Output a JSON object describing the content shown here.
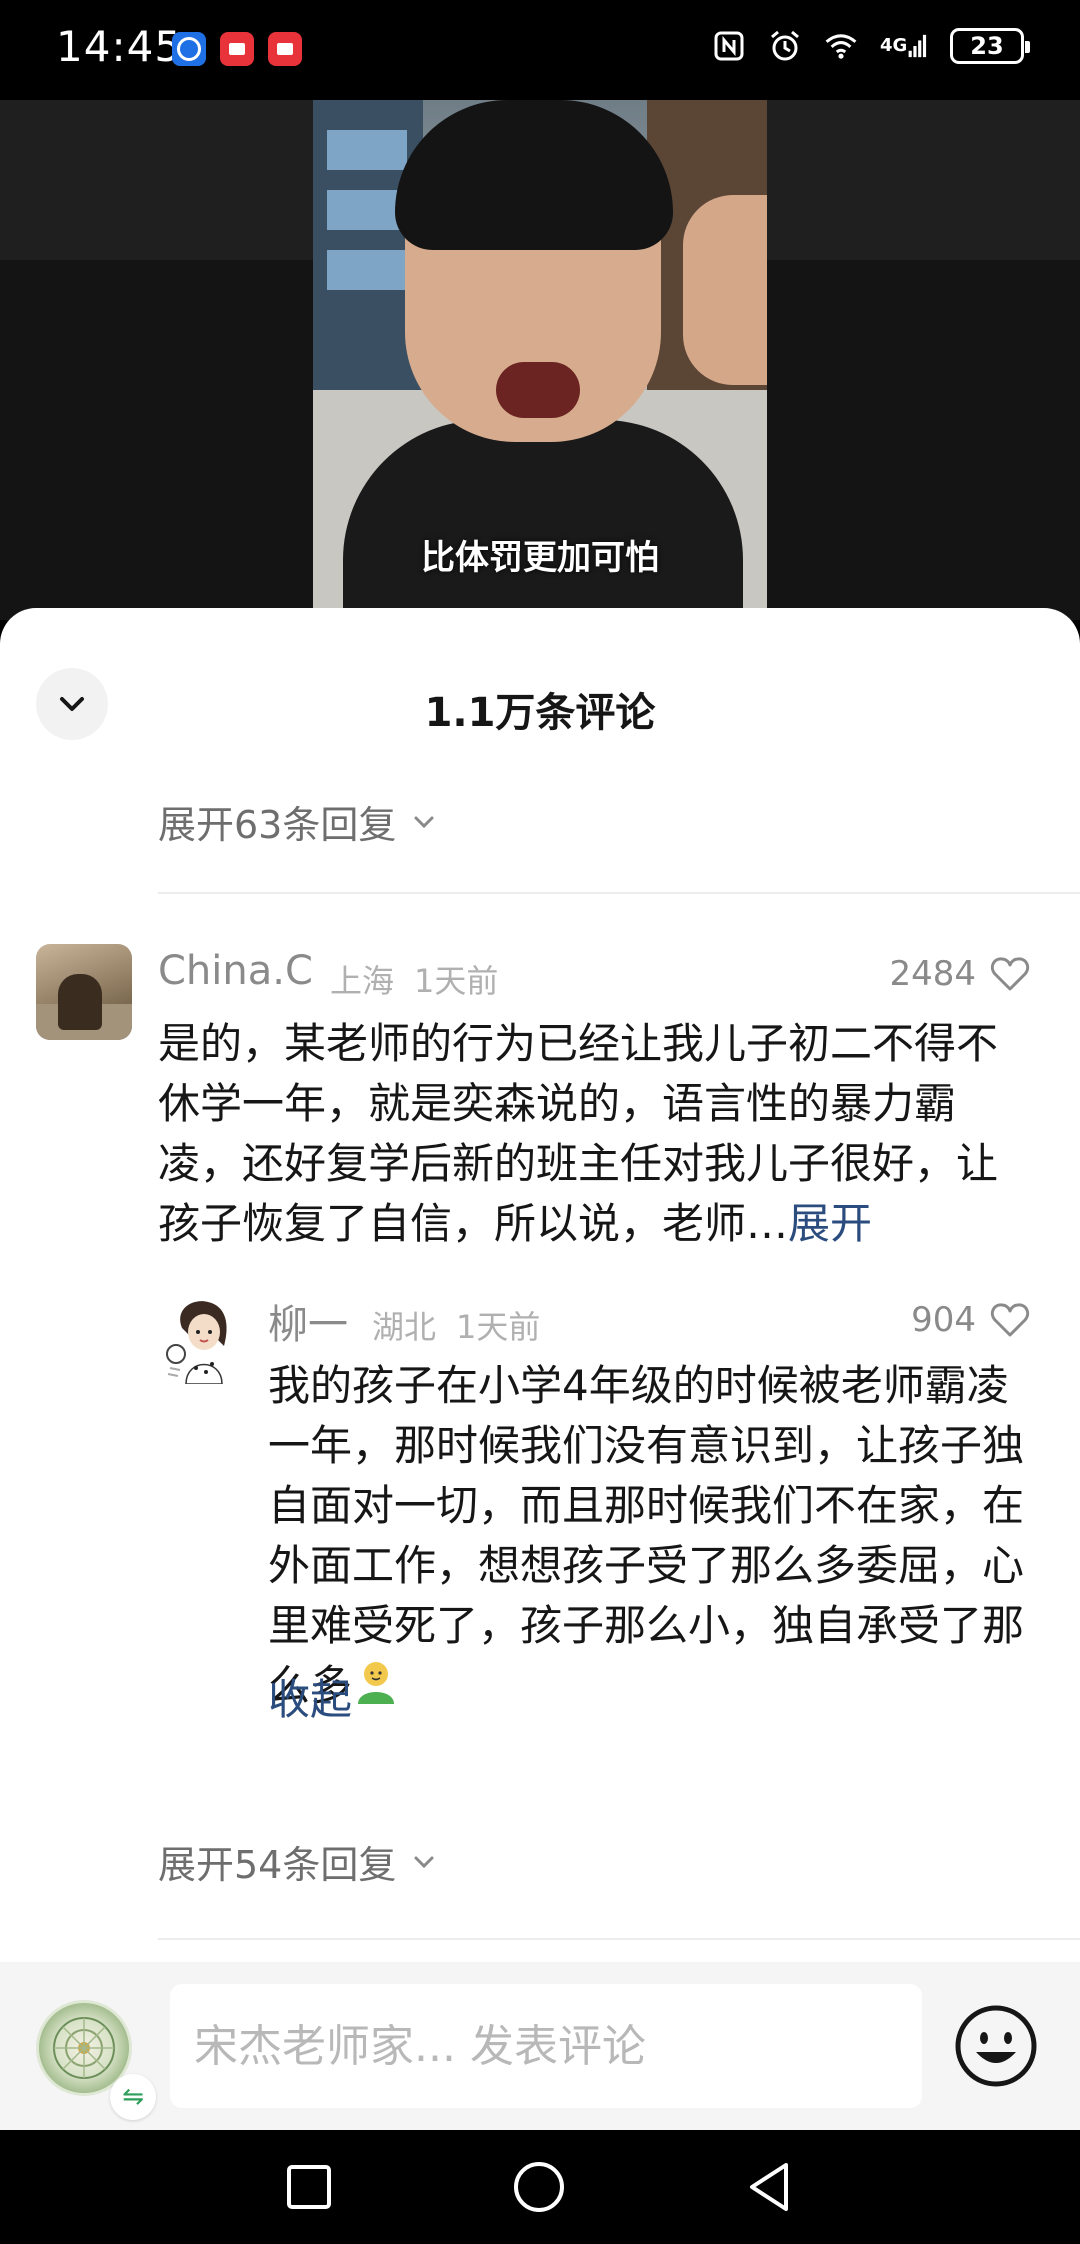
{
  "status_bar": {
    "time": "14:45",
    "network": "4G",
    "battery": "23"
  },
  "video": {
    "subtitle": "比体罚更加可怕"
  },
  "sheet": {
    "title": "1.1万条评论",
    "expand_top": "展开63条回复",
    "expand_bottom": "展开54条回复"
  },
  "comment": {
    "name": "China.C",
    "location": "上海",
    "time": "1天前",
    "likes": "2484",
    "text": "是的，某老师的行为已经让我儿子初二不得不休学一年，就是奕森说的，语言性的暴力霸凌，还好复学后新的班主任对我儿子很好，让孩子恢复了自信，所以说，老师…",
    "more": "展开"
  },
  "reply": {
    "name": "柳一",
    "location": "湖北",
    "time": "1天前",
    "likes": "904",
    "text": "我的孩子在小学4年级的时候被老师霸凌一年，那时候我们没有意识到，让孩子独自面对一切，而且那时候我们不在家，在外面工作，想想孩子受了那么多委屈，心里难受死了，孩子那么小，独自承受了那么多",
    "collapse": "收起"
  },
  "input_bar": {
    "placeholder": "宋杰老师家... 发表评论"
  },
  "colors": {
    "link": "#2b4c7e",
    "muted": "#8a8a8a",
    "sheet_bg": "#ffffff"
  },
  "icons": {
    "status": [
      "nfc-icon",
      "alarm-icon",
      "wifi-icon",
      "signal-icon",
      "battery-icon"
    ],
    "nav": [
      "recents-square-icon",
      "home-circle-icon",
      "back-triangle-icon"
    ]
  }
}
